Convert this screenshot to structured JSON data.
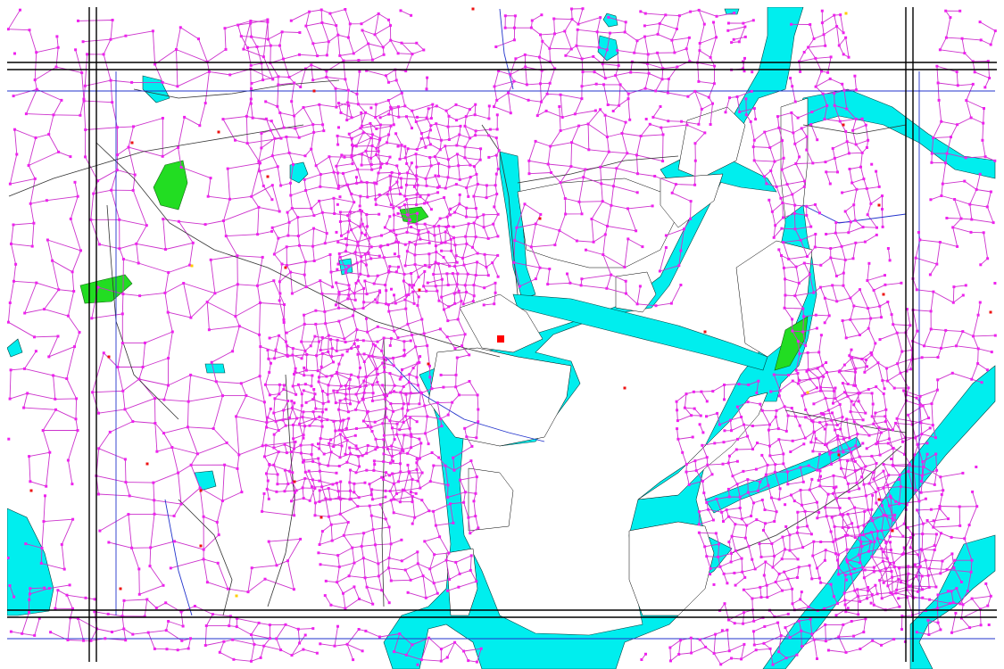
{
  "map": {
    "type": "vector-street-network",
    "colors": {
      "background": "#ffffff",
      "water": "#00eeee",
      "park": "#22dd22",
      "road_node": "#ee22ee",
      "road_link": "#cc33cc",
      "road_outline": "#000000",
      "sheet_grid": "#000000",
      "admin_boundary": "#2233cc",
      "poi": "#ee1111",
      "poi_alt": "#ffcc00",
      "major_poi": "#ff0000"
    },
    "layers": [
      "sheet-grid",
      "water",
      "parks",
      "road-network",
      "nodes",
      "admin-boundaries",
      "poi"
    ],
    "features": {
      "sheet_grid_columns": 3,
      "sheet_grid_rows": 3,
      "rivers": [
        "bay",
        "river-east",
        "river-northeast",
        "river-southwest"
      ],
      "parks": [
        "park-north-west",
        "park-west",
        "park-center",
        "park-east"
      ],
      "ponds": 6
    }
  }
}
